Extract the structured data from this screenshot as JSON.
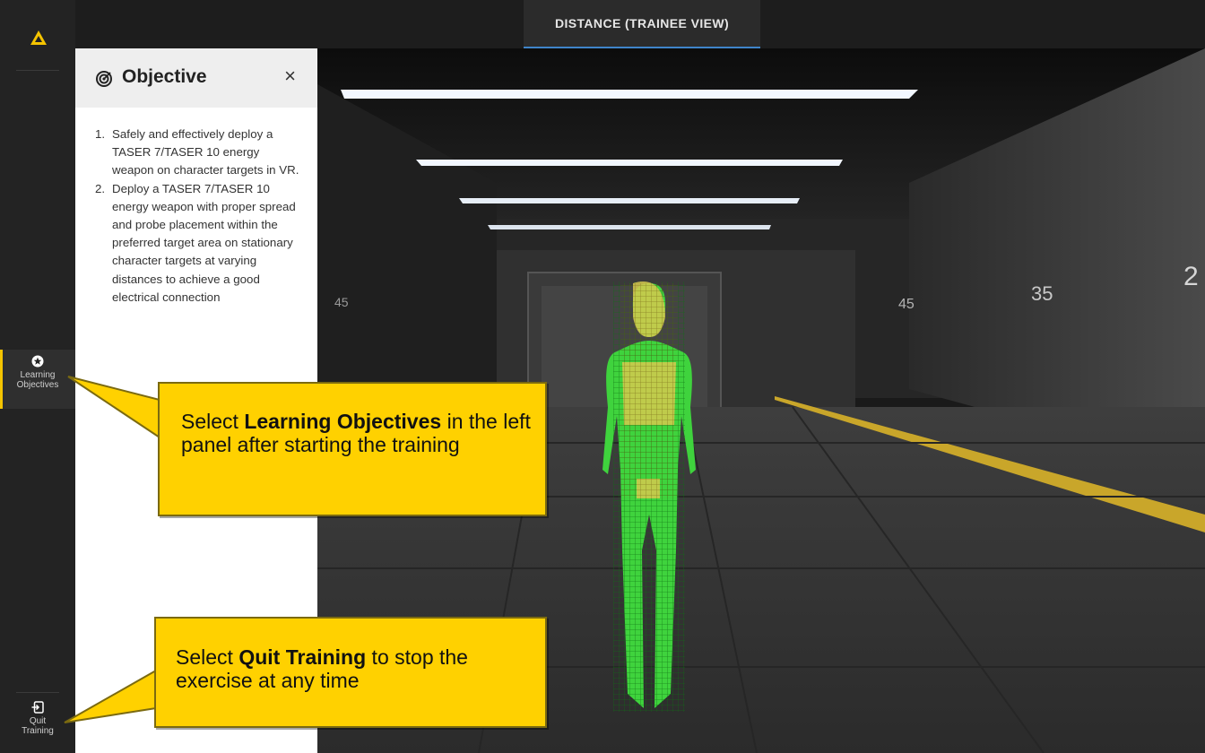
{
  "top_tab": {
    "label": "DISTANCE (TRAINEE VIEW)"
  },
  "sidebar": {
    "learning_objectives": {
      "line1": "Learning",
      "line2": "Objectives",
      "icon": "star-circle-icon"
    },
    "quit_training": {
      "line1": "Quit",
      "line2": "Training",
      "icon": "exit-icon"
    }
  },
  "objective_panel": {
    "title": "Objective",
    "close": "×",
    "items": [
      {
        "num": "1.",
        "text": "Safely and effectively deploy a TASER 7/TASER 10 energy weapon on character targets in VR."
      },
      {
        "num": "2.",
        "text": "Deploy a TASER 7/TASER 10 energy weapon with proper spread and probe placement within the preferred target area on stationary character targets at varying distances to achieve a good electrical connection"
      }
    ]
  },
  "scene": {
    "wall_numbers": [
      "45",
      "45",
      "35",
      "2"
    ]
  },
  "callouts": {
    "learning": {
      "pre": "Select ",
      "bold": "Learning Objectives",
      "post": " in the left panel after starting the training"
    },
    "quit": {
      "pre": "Select ",
      "bold": "Quit Training",
      "post": " to stop the exercise at any time"
    }
  },
  "colors": {
    "accent_yellow": "#ffd100",
    "tab_underline": "#3f84c9",
    "target_green": "#35d43a"
  }
}
